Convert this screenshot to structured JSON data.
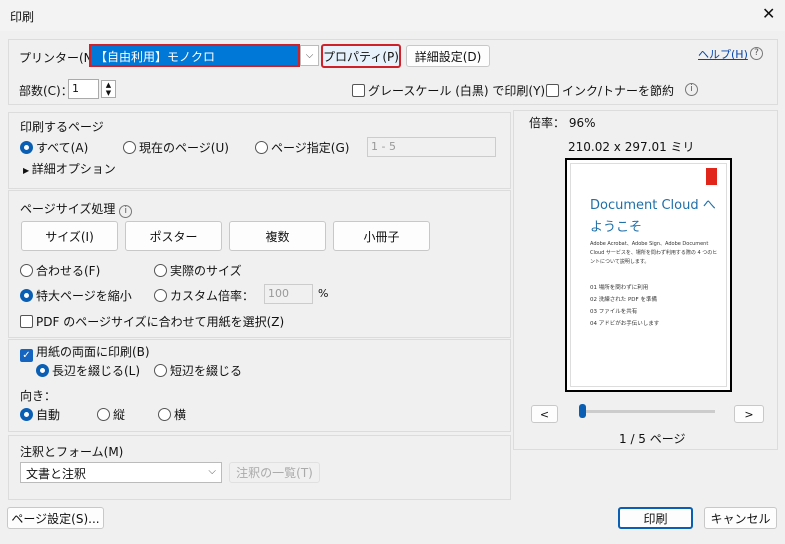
{
  "window": {
    "title": "印刷",
    "close_icon": "close-icon"
  },
  "printer": {
    "label": "プリンター(N)：",
    "value": "【自由利用】モノクロ",
    "properties": "プロパティ(P)",
    "advanced": "詳細設定(D)",
    "help": "ヘルプ(H)"
  },
  "copies": {
    "label": "部数(C)：",
    "value": "1"
  },
  "options": {
    "grayscale": "グレースケール (白黒) で印刷(Y)",
    "grayscale_checked": false,
    "save_ink": "インク/トナーを節約",
    "save_ink_checked": false
  },
  "pages": {
    "title": "印刷するページ",
    "all": "すべて(A)",
    "current": "現在のページ(U)",
    "range": "ページ指定(G)",
    "range_value": "1 - 5",
    "selected": "all",
    "more": "詳細オプション"
  },
  "page_size": {
    "title": "ページサイズ処理",
    "tabs": [
      "サイズ(I)",
      "ポスター",
      "複数",
      "小冊子"
    ],
    "fit": "合わせる(F)",
    "actual": "実際のサイズ",
    "shrink": "特大ページを縮小",
    "custom": "カスタム倍率：",
    "custom_value": "100",
    "percent": "%",
    "selected": "shrink",
    "pdf_paper": "PDF のページサイズに合わせて用紙を選択(Z)",
    "pdf_paper_checked": false
  },
  "duplex": {
    "label": "用紙の両面に印刷(B)",
    "checked": true,
    "long": "長辺を綴じる(L)",
    "short": "短辺を綴じる",
    "selected": "long"
  },
  "orientation": {
    "label": "向き：",
    "auto": "自動",
    "portrait": "縦",
    "landscape": "横",
    "selected": "auto"
  },
  "comments": {
    "label": "注釈とフォーム(M)",
    "value": "文書と注釈",
    "summary": "注釈の一覧(T)"
  },
  "preview": {
    "zoom": "倍率： 96%",
    "size": "210.02 x 297.01 ミリ",
    "heading1": "Document Cloud へ",
    "heading2": "ようこそ",
    "body": "Adobe Acrobat、Adobe Sign、Adobe Document Cloud サービスを、場所を問わず利用する際の 4 つのヒントについて説明します。",
    "items": [
      "01 場所を問わずに利用",
      "02 洗練された PDF を準備",
      "03 ファイルを共有",
      "04 アドビがお手伝いします"
    ],
    "prev": "<",
    "next": ">",
    "page": "1 / 5 ページ",
    "slider_fraction": 0,
    "accent": "#1f6fa8",
    "logo_color": "#e1251b"
  },
  "footer": {
    "page_setup": "ページ設定(S)...",
    "print": "印刷",
    "cancel": "キャンセル"
  },
  "colors": {
    "highlight": "#0078d7",
    "red_outline": "#d0202a"
  }
}
